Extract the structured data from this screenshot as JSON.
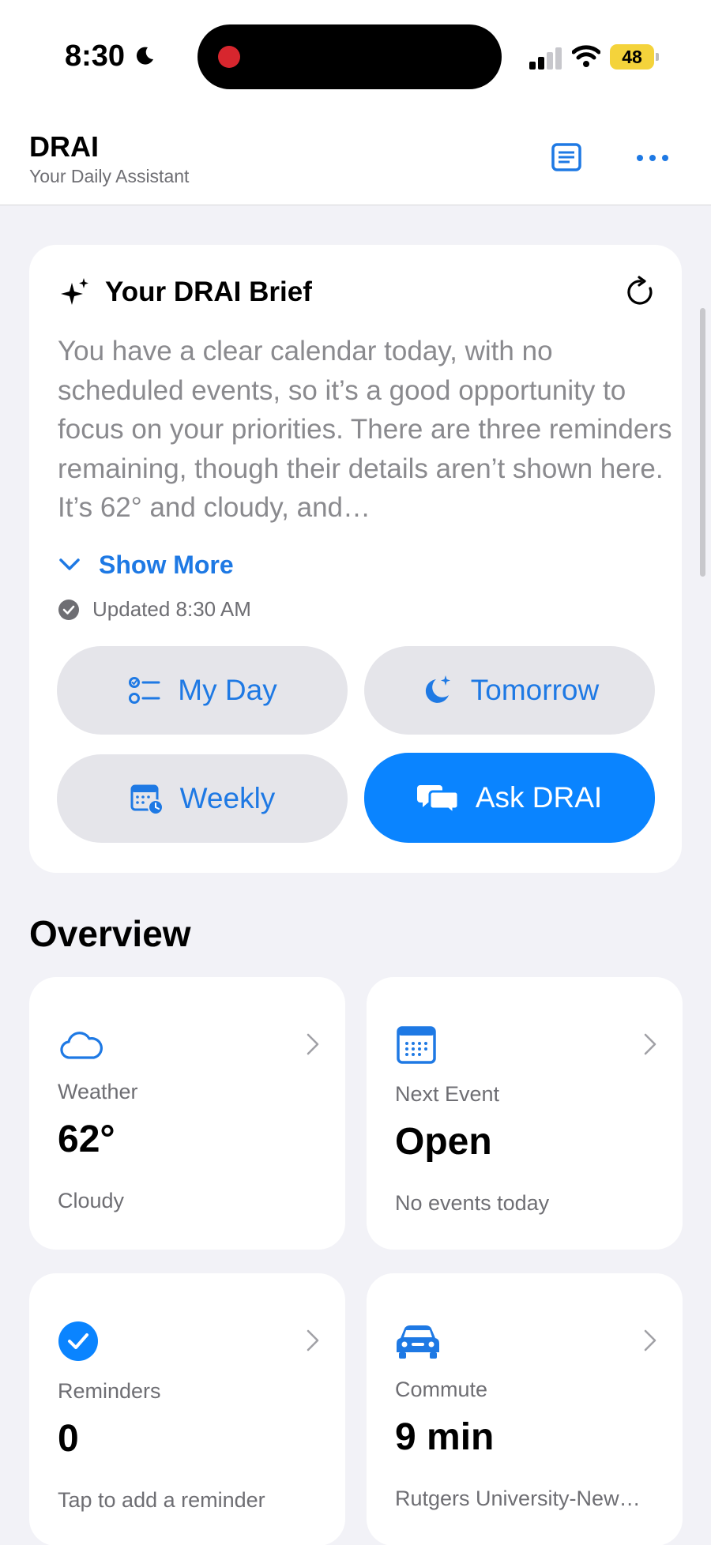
{
  "status_bar": {
    "time": "8:30",
    "battery": "48",
    "colors": {
      "recording": "#D7262E",
      "battery": "#F4D33B"
    }
  },
  "header": {
    "title": "DRAI",
    "subtitle": "Your Daily Assistant",
    "icons": [
      "document-icon",
      "more-icon"
    ]
  },
  "brief": {
    "title": "Your DRAI Brief",
    "text": "You have a clear calendar today, with no scheduled events, so it’s a good opportunity to focus on your priorities. There are three reminders remaining, though their details aren’t shown here. It’s 62° and cloudy, and…",
    "show_more": "Show More",
    "updated": "Updated 8:30 AM",
    "buttons": {
      "my_day": "My Day",
      "tomorrow": "Tomorrow",
      "weekly": "Weekly",
      "ask": "Ask DRAI"
    },
    "accent": "#0A84FF"
  },
  "overview": {
    "title": "Overview",
    "tiles": {
      "weather": {
        "label": "Weather",
        "value": "62°",
        "sub": "Cloudy",
        "icon": "cloud-icon"
      },
      "next_event": {
        "label": "Next Event",
        "value": "Open",
        "sub": "No events today",
        "icon": "calendar-icon"
      },
      "reminders": {
        "label": "Reminders",
        "value": "0",
        "sub": "Tap to add a reminder",
        "icon": "checkmark-circle-icon"
      },
      "commute": {
        "label": "Commute",
        "value": "9 min",
        "sub": "Rutgers University-New…",
        "icon": "car-icon"
      }
    }
  }
}
